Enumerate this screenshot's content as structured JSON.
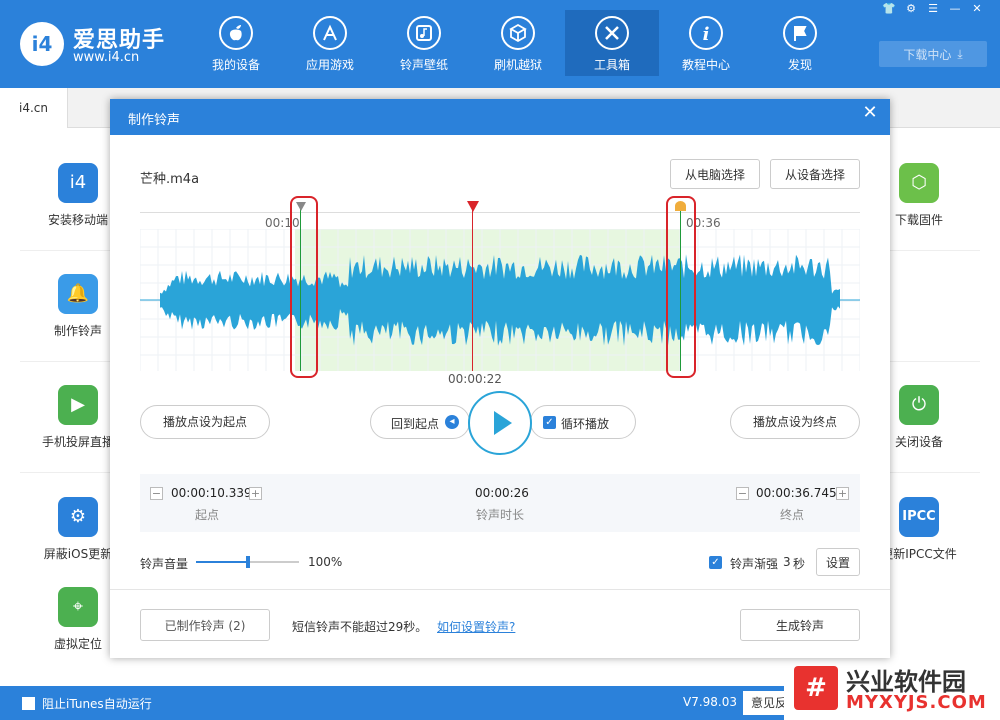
{
  "app": {
    "name": "爱思助手",
    "url": "www.i4.cn",
    "logo_text": "i4"
  },
  "nav": [
    {
      "label": "我的设备",
      "icon": "apple-icon"
    },
    {
      "label": "应用游戏",
      "icon": "app-store-icon"
    },
    {
      "label": "铃声壁纸",
      "icon": "music-icon"
    },
    {
      "label": "刷机越狱",
      "icon": "box-icon"
    },
    {
      "label": "工具箱",
      "icon": "tools-icon",
      "active": true
    },
    {
      "label": "教程中心",
      "icon": "info-icon"
    },
    {
      "label": "发现",
      "icon": "flag-icon"
    }
  ],
  "download_center": "下载中心",
  "tabs": [
    {
      "label": "i4.cn"
    }
  ],
  "tools_left": [
    {
      "label": "安装移动端",
      "color": "#2b81da"
    },
    {
      "label": "制作铃声",
      "color": "#3a9be8"
    },
    {
      "label": "手机投屏直播",
      "color": "#4cb050"
    },
    {
      "label": "屏蔽iOS更新",
      "color": "#2b81da"
    },
    {
      "label": "虚拟定位",
      "color": "#4cb050"
    }
  ],
  "tools_right": [
    {
      "label": "下载固件",
      "color": "#6cc04a"
    },
    {
      "label": "关闭设备",
      "color": "#4cb050"
    },
    {
      "label": "更新IPCC文件",
      "color": "#2b81da",
      "icon_text": "IPCC"
    }
  ],
  "status": {
    "itunes": "阻止iTunes自动运行",
    "version": "V7.98.03",
    "feedback": "意见反"
  },
  "watermark": {
    "logo": "#",
    "name": "兴业软件园",
    "url": "MYXYJS.COM"
  },
  "dialog": {
    "title": "制作铃声",
    "file_name": "芒种.m4a",
    "from_pc": "从电脑选择",
    "from_device": "从设备选择",
    "marker_start": "00:10",
    "marker_end": "00:36",
    "playhead_time": "00:00:22",
    "set_start": "播放点设为起点",
    "back_to_start": "回到起点",
    "loop": "循环播放",
    "set_end": "播放点设为终点",
    "start_value": "00:00:10.339",
    "start_label": "起点",
    "duration_value": "00:00:26",
    "duration_label": "铃声时长",
    "end_value": "00:00:36.745",
    "end_label": "终点",
    "volume_label": "铃声音量",
    "volume_value": "100%",
    "volume_level": 0.5,
    "fade_label": "铃声渐强",
    "fade_seconds": "3",
    "fade_unit": "秒",
    "settings": "设置",
    "made_count": "已制作铃声 (2)",
    "sms_hint": "短信铃声不能超过29秒。",
    "howto_link": "如何设置铃声?",
    "generate": "生成铃声",
    "colors": {
      "wave": "#2aa4d8",
      "selection": "#e7f7e0",
      "marker_start": "#1f9a3a",
      "playhead": "#d9242a",
      "highlight": "#d9242a"
    }
  }
}
